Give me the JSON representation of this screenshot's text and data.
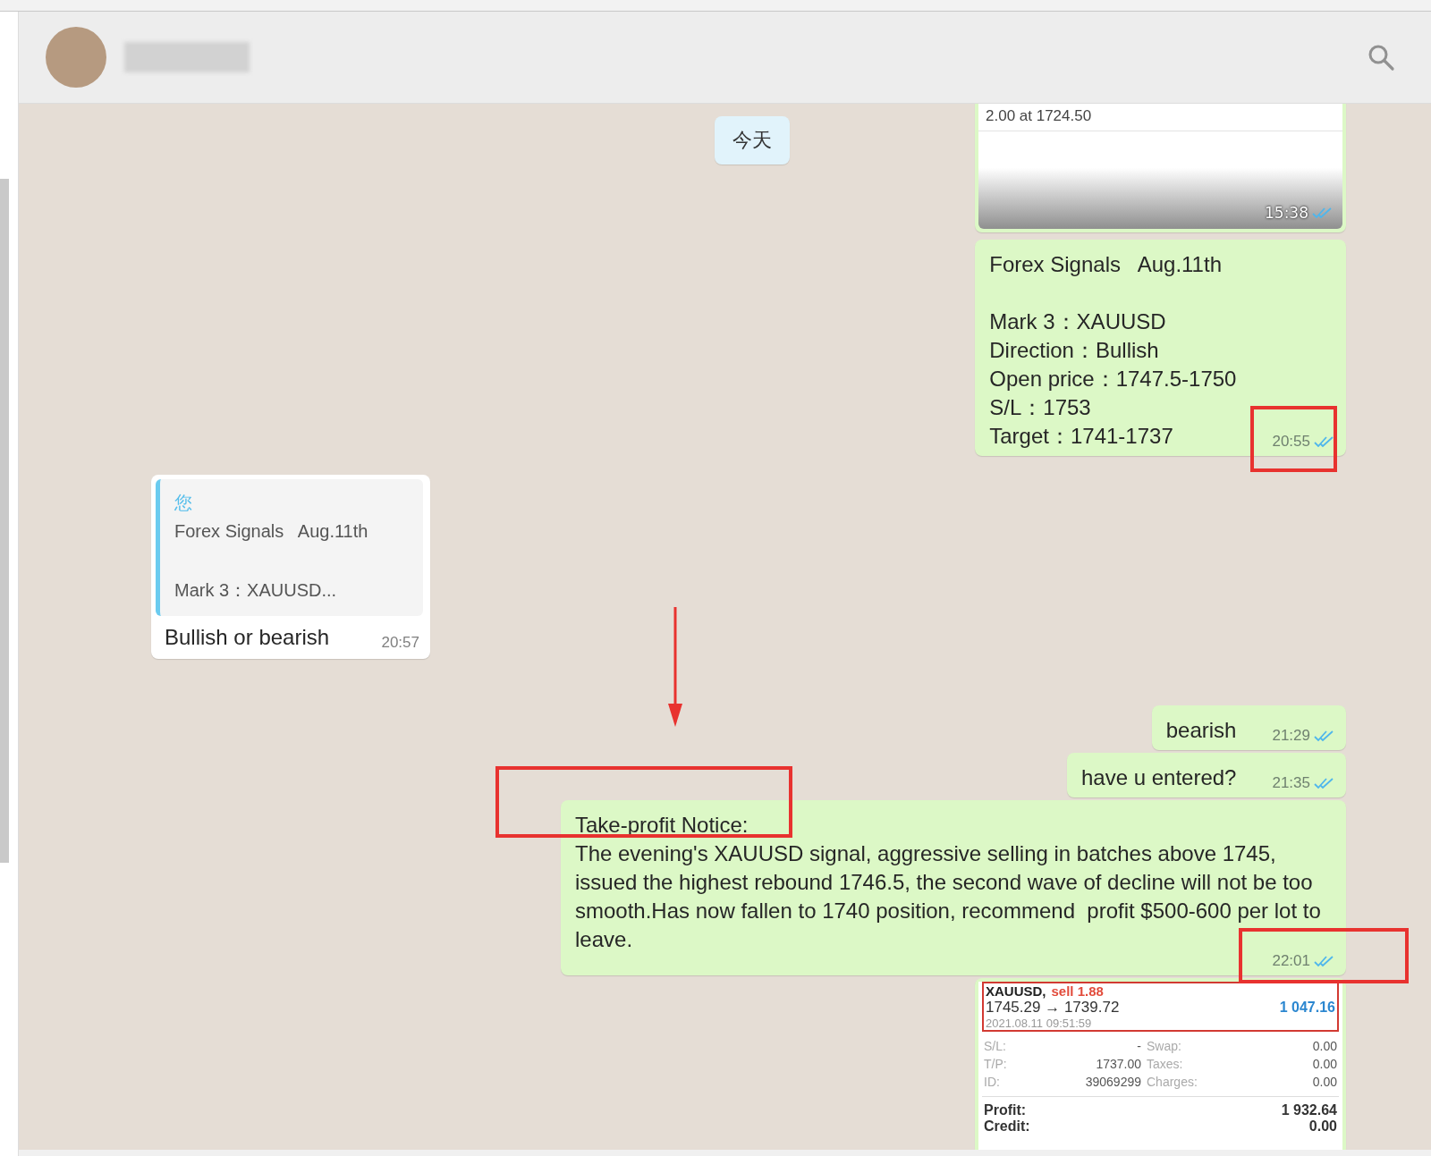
{
  "date_chip": "今天",
  "messages": [
    {
      "kind": "image",
      "outgoing": true,
      "image_text": "2.00 at 1724.50",
      "time": "15:38",
      "read": true
    },
    {
      "kind": "text",
      "outgoing": true,
      "text": "Forex Signals   Aug.11th\n\nMark 3：XAUUSD\nDirection：Bullish\nOpen price：1747.5-1750\nS/L：1753\nTarget：1741-1737",
      "time": "20:55",
      "read": true
    },
    {
      "kind": "reply",
      "outgoing": false,
      "quote": {
        "author": "您",
        "text": "Forex Signals   Aug.11th\n\nMark 3：XAUUSD..."
      },
      "text": "Bullish or bearish",
      "time": "20:57"
    },
    {
      "kind": "text",
      "outgoing": true,
      "text": "bearish",
      "time": "21:29",
      "read": true
    },
    {
      "kind": "text",
      "outgoing": true,
      "text": "have u entered?",
      "time": "21:35",
      "read": true
    },
    {
      "kind": "text",
      "outgoing": true,
      "text": "Take-profit Notice:\nThe evening's XAUUSD signal, aggressive selling in batches above 1745, issued the highest rebound 1746.5, the second wave of decline will not be too smooth.Has now fallen to 1740 position, recommend  profit $500-600 per lot to leave.",
      "time": "22:01",
      "read": true
    },
    {
      "kind": "trade",
      "outgoing": true,
      "trade": {
        "symbol": "XAUUSD,",
        "side": "sell 1.88",
        "prices": "1745.29 → 1739.72",
        "result": "1 047.16",
        "opened": "2021.08.11 09:51:59",
        "details": [
          {
            "label": "S/L:",
            "value": "-",
            "label_2": "Swap:",
            "value_2": "0.00"
          },
          {
            "label": "T/P:",
            "value": "1737.00",
            "label_2": "Taxes:",
            "value_2": "0.00"
          },
          {
            "label": "ID:",
            "value": "39069299",
            "label_2": "Charges:",
            "value_2": "0.00"
          }
        ],
        "totals": [
          {
            "label": "Profit:",
            "value": "1 932.64"
          },
          {
            "label": "Credit:",
            "value": "0.00"
          }
        ]
      }
    }
  ]
}
